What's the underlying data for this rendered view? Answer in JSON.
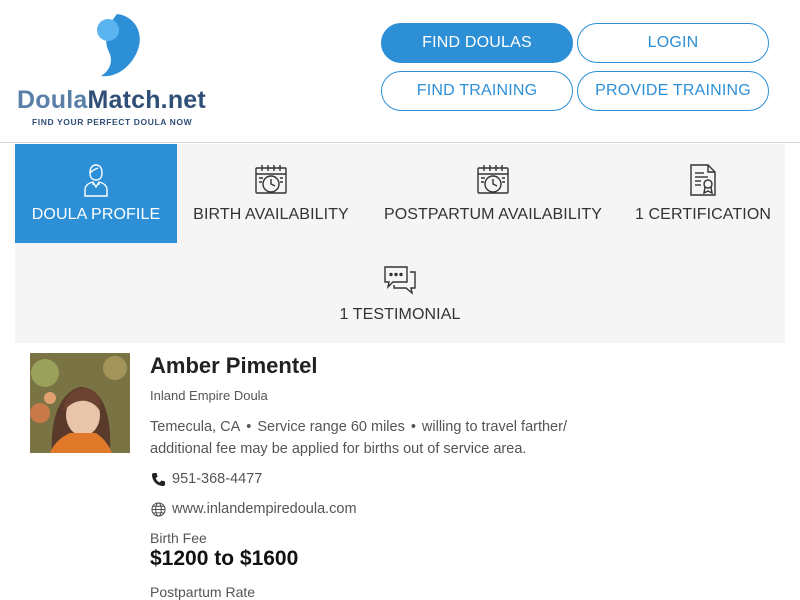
{
  "logo": {
    "word_part1": "Doula",
    "word_part2": "Match.net",
    "tagline": "FIND YOUR PERFECT DOULA NOW",
    "colors": {
      "primary": "#2d8fd6",
      "light": "#5ab4f0",
      "dark": "#2f4f77"
    }
  },
  "nav": {
    "find_doulas": "FIND DOULAS",
    "login": "LOGIN",
    "find_training": "FIND TRAINING",
    "provide_training": "PROVIDE TRAINING"
  },
  "tabs": [
    {
      "label": "DOULA PROFILE",
      "icon": "person-icon",
      "active": true
    },
    {
      "label": "BIRTH AVAILABILITY",
      "icon": "calendar-clock-icon",
      "active": false
    },
    {
      "label": "POSTPARTUM AVAILABILITY",
      "icon": "calendar-clock-icon",
      "active": false
    },
    {
      "label": "1 CERTIFICATION",
      "icon": "certificate-icon",
      "active": false
    },
    {
      "label": "1 TESTIMONIAL",
      "icon": "chat-bubbles-icon",
      "active": false
    }
  ],
  "profile": {
    "name": "Amber Pimentel",
    "subtitle": "Inland Empire Doula",
    "city": "Temecula, CA",
    "service_range": "Service range 60 miles",
    "travel_note": "willing to travel farther/ additional fee may be applied for births out of service area.",
    "phone": "951-368-4477",
    "website": "www.inlandempiredoula.com",
    "birth_fee_label": "Birth Fee",
    "birth_fee": "$1200 to $1600",
    "postpartum_rate_label": "Postpartum Rate"
  },
  "colors": {
    "accent": "#2d8fd6",
    "tab_bg": "#f5f5f5",
    "text": "#333333"
  }
}
